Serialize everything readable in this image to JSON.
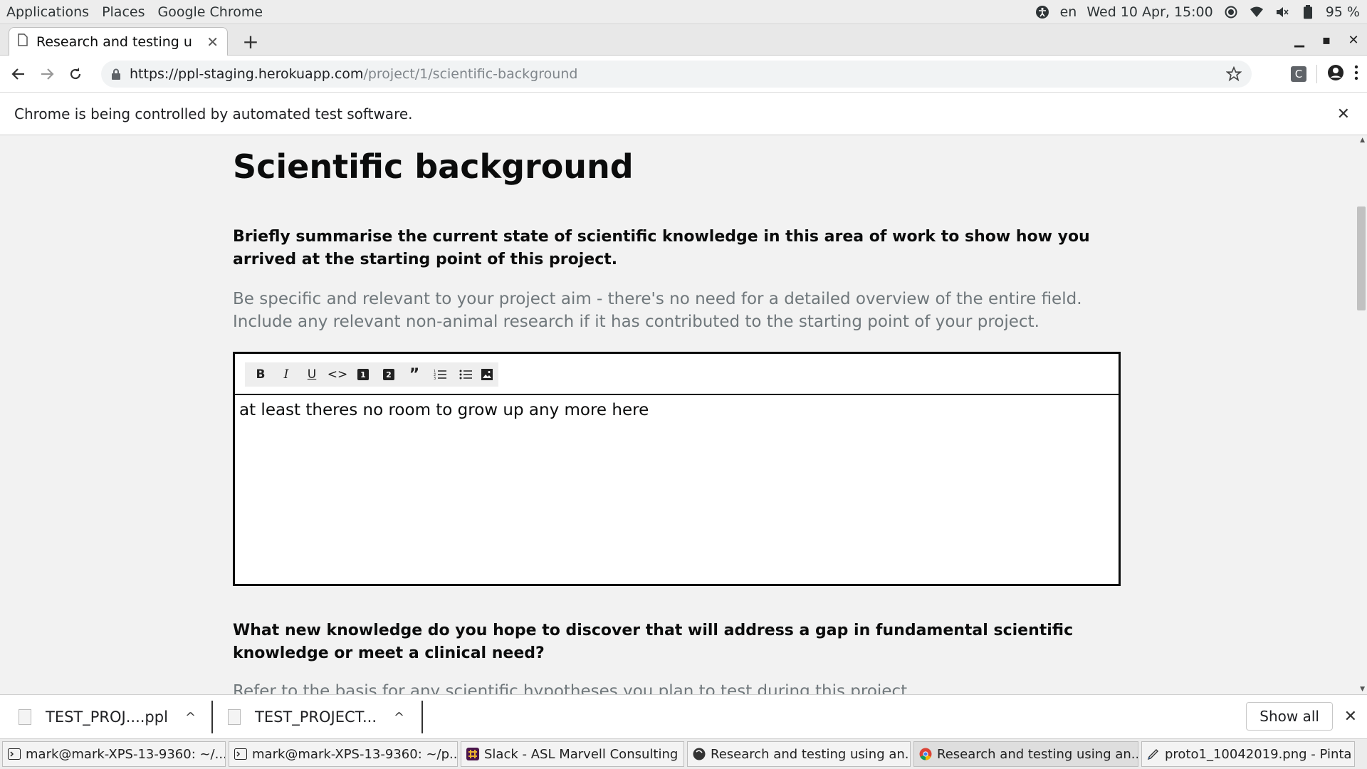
{
  "topbar": {
    "applications": "Applications",
    "places": "Places",
    "app_name": "Google Chrome",
    "language": "en",
    "datetime": "Wed 10 Apr, 15:00",
    "battery": "95 %"
  },
  "tab": {
    "title": "Research and testing u"
  },
  "address": {
    "host": "https://ppl-staging.herokuapp.com",
    "path": "/project/1/scientific-background"
  },
  "toolbar": {
    "extension_letter": "C"
  },
  "infobar": {
    "message": "Chrome is being controlled by automated test software."
  },
  "page": {
    "title": "Scientific background",
    "question1": "Briefly summarise the current state of scientific knowledge in this area of work to show how you arrived at the starting point of this project.",
    "hint1": "Be specific and relevant to your project aim - there's no need for a detailed overview of the entire field. Include any relevant non-animal research if it has contributed to the starting point of your project.",
    "editor_value": "at least theres no room to grow up any more here",
    "editor_tools": [
      "bold-icon",
      "italic-icon",
      "underline-icon",
      "code-icon",
      "heading-1-icon",
      "heading-2-icon",
      "quote-icon",
      "ordered-list-icon",
      "bullet-list-icon",
      "image-icon"
    ],
    "tool_h1": "1",
    "tool_h2": "2",
    "question2": "What new knowledge do you hope to discover that will address a gap in fundamental scientific knowledge or meet a clinical need?",
    "hint2": "Refer to the basis for any scientific hypotheses you plan to test during this project."
  },
  "downloads": {
    "items": [
      "TEST_PROJ....ppl",
      "TEST_PROJECT..."
    ],
    "show_all": "Show all"
  },
  "taskbar": {
    "items": [
      "mark@mark-XPS-13-9360: ~/...",
      "mark@mark-XPS-13-9360: ~/p...",
      "Slack - ASL Marvell Consulting",
      "Research and testing using an...",
      "Research and testing using an...",
      "proto1_10042019.png - Pinta"
    ]
  }
}
